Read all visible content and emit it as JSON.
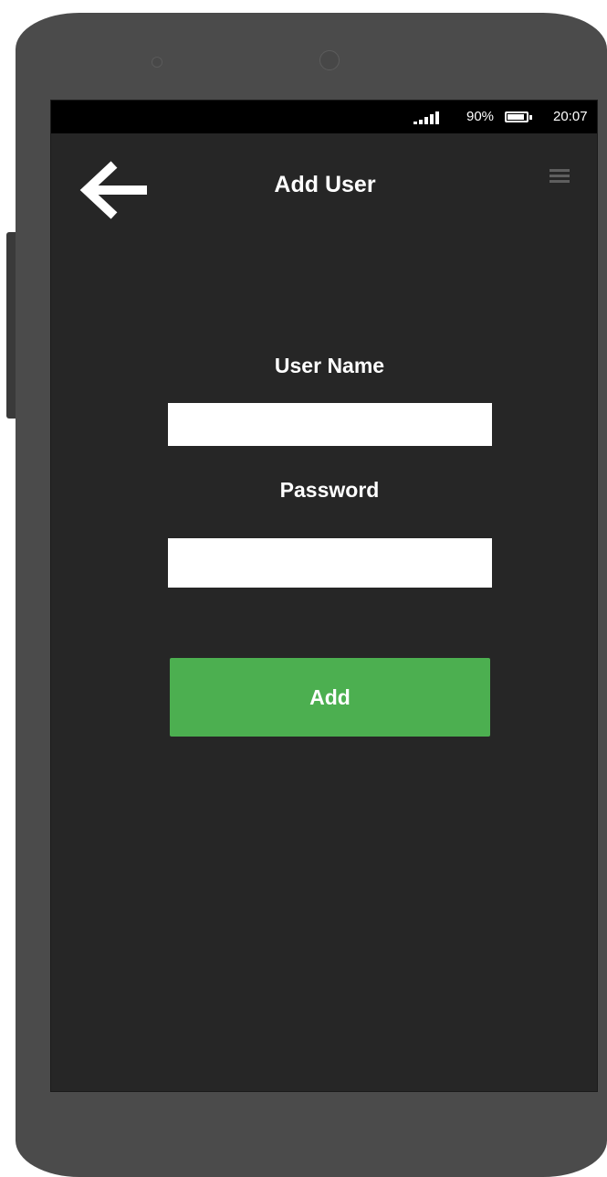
{
  "status_bar": {
    "battery_percent_label": "90%",
    "battery_level": 0.9,
    "time": "20:07",
    "signal_icon": "signal-icon",
    "battery_icon": "battery-icon"
  },
  "header": {
    "title": "Add User",
    "back_icon": "arrow-left-icon",
    "menu_icon": "hamburger-menu-icon"
  },
  "form": {
    "username_label": "User Name",
    "username_value": "",
    "password_label": "Password",
    "password_value": "",
    "submit_label": "Add"
  },
  "colors": {
    "screen_background": "#262626",
    "status_bar": "#000000",
    "accent": "#4caf50",
    "phone_body": "#4b4b4b"
  }
}
